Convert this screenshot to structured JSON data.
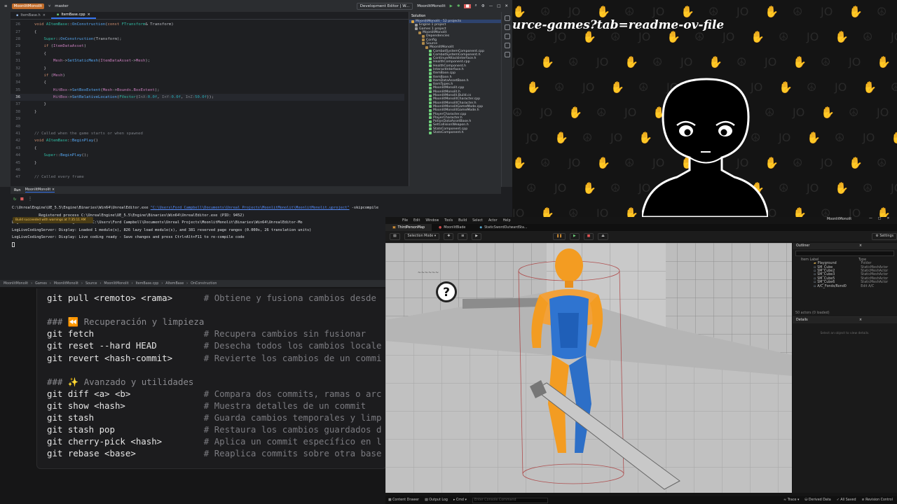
{
  "ide": {
    "project": "MoonlitMonolit",
    "branch": "master",
    "config": "Development Editor | W...",
    "target": "MoonlitMonolit",
    "tabs": [
      {
        "label": "ItemBase.h",
        "active": false
      },
      {
        "label": "ItemBase.cpp",
        "active": true
      }
    ],
    "code_lines": [
      {
        "n": "26",
        "html": "<span class='kw'>void</span> <span class='ty'>AItemBase</span>::<span class='fn'>OnConstruction</span>(<span class='kw'>const</span> <span class='ty'>FTransform</span>& Transform)"
      },
      {
        "n": "27",
        "html": "{"
      },
      {
        "n": "28",
        "html": "    <span class='ty'>Super</span>::<span class='fn'>OnConstruction</span>(Transform);"
      },
      {
        "n": "29",
        "html": "    <span class='kw'>if</span> (<span class='vr'>ItemDataAsset</span>)"
      },
      {
        "n": "30",
        "html": "    {"
      },
      {
        "n": "31",
        "html": "        <span class='vr'>Mesh</span>-><span class='fn'>SetStaticMesh</span>(<span class='vr'>ItemDataAsset</span>-><span class='vr'>Mesh</span>);"
      },
      {
        "n": "32",
        "html": "    }"
      },
      {
        "n": "33",
        "html": "    <span class='kw'>if</span> (<span class='vr'>Mesh</span>)"
      },
      {
        "n": "34",
        "html": "    {"
      },
      {
        "n": "35",
        "html": "        <span class='vr'>HitBox</span>-><span class='fn'>SetBoxExtent</span>(<span class='vr'>Mesh</span>-><span class='vr'>Bounds</span>.<span class='vr'>BoxExtent</span>);"
      },
      {
        "n": "36",
        "html": "        <span class='vr'>HitBox</span>-><span class='fn'>SetRelativeLocation</span>(<span class='ty'>FVector</span>(<span class='cm'>InX:</span><span class='nm'>0.0f</span>, <span class='cm'>InY:</span><span class='nm'>0.0f</span>, <span class='cm'>InZ:</span><span class='nm'>50.0f</span>));",
        "hl": true
      },
      {
        "n": "37",
        "html": "    }"
      },
      {
        "n": "38",
        "html": "}"
      },
      {
        "n": "39",
        "html": ""
      },
      {
        "n": "40",
        "html": ""
      },
      {
        "n": "41",
        "html": "<span class='cm'>// Called when the game starts or when spawned</span>"
      },
      {
        "n": "42",
        "html": "<span class='kw'>void</span> <span class='ty'>AItemBase</span>::<span class='fn'>BeginPlay</span>()"
      },
      {
        "n": "43",
        "html": "{"
      },
      {
        "n": "44",
        "html": "    <span class='ty'>Super</span>::<span class='fn'>BeginPlay</span>();"
      },
      {
        "n": "45",
        "html": "}"
      },
      {
        "n": "46",
        "html": ""
      },
      {
        "n": "47",
        "html": "<span class='cm'>// Called every frame</span>"
      }
    ],
    "solution": {
      "header": "Solution",
      "items": [
        {
          "label": "MoonlitMonolit · 52 projects",
          "indent": 0,
          "sel": true
        },
        {
          "label": "Engine  1 project",
          "indent": 1
        },
        {
          "label": "Games  1 project",
          "indent": 1
        },
        {
          "label": "MoonlitMonolit",
          "indent": 2
        },
        {
          "label": "Dependencies",
          "indent": 3
        },
        {
          "label": "Config",
          "indent": 3
        },
        {
          "label": "Source",
          "indent": 3
        },
        {
          "label": "MoonlitMonolit",
          "indent": 4
        },
        {
          "label": "CombatSystemComponent.cpp",
          "indent": 5
        },
        {
          "label": "CombatSystemComponent.h",
          "indent": 5
        },
        {
          "label": "ContinueAttackInterface.h",
          "indent": 5
        },
        {
          "label": "HealthComponent.cpp",
          "indent": 5
        },
        {
          "label": "HealthComponent.h",
          "indent": 5
        },
        {
          "label": "InteractInterface.h",
          "indent": 5
        },
        {
          "label": "ItemBase.cpp",
          "indent": 5
        },
        {
          "label": "ItemBase.h",
          "indent": 5
        },
        {
          "label": "ItemDataAssetBase.h",
          "indent": 5
        },
        {
          "label": "ItemTypes.h",
          "indent": 5
        },
        {
          "label": "MoonlitMonolit.cpp",
          "indent": 5
        },
        {
          "label": "MoonlitMonolit.h",
          "indent": 5
        },
        {
          "label": "MoonlitMonolit.Build.cs",
          "indent": 5
        },
        {
          "label": "MoonlitMonolitCharacter.cpp",
          "indent": 5
        },
        {
          "label": "MoonlitMonolitCharacter.h",
          "indent": 5
        },
        {
          "label": "MoonlitMonolitGameMode.cpp",
          "indent": 5
        },
        {
          "label": "MoonlitMonolitGameMode.h",
          "indent": 5
        },
        {
          "label": "PlayerCharacter.cpp",
          "indent": 5
        },
        {
          "label": "PlayerCharacter.h",
          "indent": 5
        },
        {
          "label": "PotionDataAssetBase.h",
          "indent": 5
        },
        {
          "label": "SetCollisionWeapon.h",
          "indent": 5
        },
        {
          "label": "StatsComponent.cpp",
          "indent": 5
        },
        {
          "label": "StatsComponent.h",
          "indent": 5
        }
      ]
    },
    "run": {
      "label": "Run",
      "tab": "MoonlitMonolit",
      "console": [
        "C:\\UnrealEngine\\UE_5.5\\Engine\\Binaries\\Win64\\UnrealEditor.exe ",
        "            Registered process C:\\UnrealEngine\\UE_5.5\\Engine\\Binaries\\Win64\\UnrealEditor.exe (PID: 9452)",
        "LogLiveCodingServer: Loading module C:\\Users\\Ford Campbell\\Documents\\Unreal Projects\\MoonlitMonolit\\Binaries\\Win64\\UnrealEditor-Mo",
        "LogLiveCodingServer: Display: Loaded 1 module(s), 826 lazy load module(s), and 381 reserved page ranges (0.000s, 26 translation units)",
        "LogLiveCodingServer: Display: Live coding ready - Save changes and press Ctrl+Alt+F11 to re-compile code"
      ],
      "console_link": "\"C:\\Users\\Ford Campbell\\Documents\\Unreal Projects\\MoonlitMonolit\\MoonlitMonolit.uproject\"",
      "console_tail": " -skipcompile",
      "toast": "Build succeeded with warnings at 7:35:11 AM"
    },
    "status_path": [
      "MoonlitMonolit",
      "Games",
      "MoonlitMonolit",
      "Source",
      "MoonlitMonolit",
      "ItemBase.cpp",
      "AItemBase",
      "OnConstruction"
    ]
  },
  "git": {
    "lines": [
      {
        "cmd": "git pull <remoto> <rama>",
        "comment": "# Obtiene y fusiona cambios desde",
        "kind": "cmd"
      },
      {
        "cmd": "",
        "comment": "",
        "kind": "blank"
      },
      {
        "cmd": "### ⏪ Recuperación y limpieza",
        "comment": "",
        "kind": "hdr"
      },
      {
        "cmd": "git fetch",
        "comment": "# Recupera cambios sin fusionar",
        "kind": "cmd"
      },
      {
        "cmd": "git reset --hard HEAD",
        "comment": "# Desecha todos los cambios locale",
        "kind": "cmd"
      },
      {
        "cmd": "git revert <hash-commit>",
        "comment": "# Revierte los cambios de un commi",
        "kind": "cmd"
      },
      {
        "cmd": "",
        "comment": "",
        "kind": "blank"
      },
      {
        "cmd": "### ✨ Avanzado y utilidades",
        "comment": "",
        "kind": "hdr"
      },
      {
        "cmd": "git diff <a> <b>",
        "comment": "# Compara dos commits, ramas o arc",
        "kind": "cmd"
      },
      {
        "cmd": "git show <hash>",
        "comment": "# Muestra detalles de un commit",
        "kind": "cmd"
      },
      {
        "cmd": "git stash",
        "comment": "# Guarda cambios temporales y limp",
        "kind": "cmd"
      },
      {
        "cmd": "git stash pop",
        "comment": "# Restaura los cambios guardados d",
        "kind": "cmd"
      },
      {
        "cmd": "git cherry-pick <hash>",
        "comment": "# Aplica un commit específico en l",
        "kind": "cmd"
      },
      {
        "cmd": "git rebase <base>",
        "comment": "# Reaplica commits sobre otra base",
        "kind": "cmd"
      }
    ]
  },
  "stream": {
    "url": "urce-games?tab=readme-ov-file"
  },
  "unreal": {
    "window_title": "MoonlitMonolit",
    "menu": [
      "File",
      "Edit",
      "Window",
      "Tools",
      "Build",
      "Select",
      "Actor",
      "Help"
    ],
    "tabs": [
      "ThirdPersonMap",
      "MoonlitBlade",
      "StaticSwordOutwardSta..."
    ],
    "mode": "Selection Mode",
    "settings": "Settings",
    "outliner": {
      "title": "Outliner",
      "col_label": "Item Label",
      "col_type": "Type",
      "rows": [
        {
          "label": "Playground",
          "type": "Folder"
        },
        {
          "label": "SM_Cube",
          "type": "StaticMeshActor"
        },
        {
          "label": "SM_Cube2",
          "type": "StaticMeshActor"
        },
        {
          "label": "SM_Cube3",
          "type": "StaticMeshActor"
        },
        {
          "label": "SM_Cube5",
          "type": "StaticMeshActor"
        },
        {
          "label": "SM_Cube6",
          "type": "StaticMeshActor"
        },
        {
          "label": "A/C_Fonds/Rond0",
          "type": "Edit A/C"
        }
      ],
      "count": "50 actors (0 loaded)"
    },
    "details": {
      "title": "Details",
      "empty": "Select an object to view details."
    },
    "status": {
      "content_drawer": "Content Drawer",
      "output_log": "Output Log",
      "cmd": "Cmd",
      "console_placeholder": "Enter Console Command",
      "trace": "Trace",
      "derived": "Derived Data",
      "saved": "All Saved",
      "revision": "Revision Control"
    }
  }
}
